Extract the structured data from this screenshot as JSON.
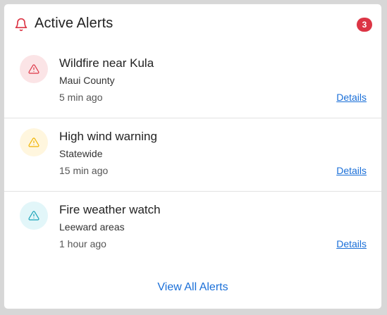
{
  "header": {
    "title": "Active Alerts",
    "count": "3",
    "icon": "bell-icon",
    "icon_color": "#dc3545",
    "badge_color": "#dc3545"
  },
  "alerts": [
    {
      "title": "Wildfire near Kula",
      "location": "Maui County",
      "time": "5 min ago",
      "link": "Details",
      "icon": "warning-triangle-icon",
      "icon_color": "#dc3545",
      "icon_bg": "#fbe4e6"
    },
    {
      "title": "High wind warning",
      "location": "Statewide",
      "time": "15 min ago",
      "link": "Details",
      "icon": "warning-triangle-icon",
      "icon_color": "#f0b400",
      "icon_bg": "#fff6de"
    },
    {
      "title": "Fire weather watch",
      "location": "Leeward areas",
      "time": "1 hour ago",
      "link": "Details",
      "icon": "warning-triangle-icon",
      "icon_color": "#17a2b8",
      "icon_bg": "#e2f6f9"
    }
  ],
  "footer": {
    "view_all": "View All Alerts",
    "link_color": "#1a6fd8"
  }
}
